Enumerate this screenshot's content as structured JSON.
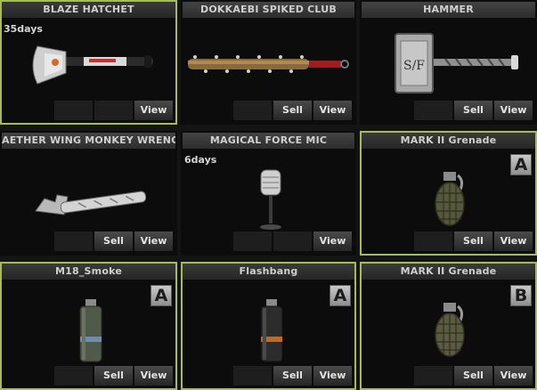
{
  "cards": [
    {
      "name": "BLAZE HATCHET",
      "days": "35days",
      "grade": "",
      "selected": true,
      "buttons": [
        "View"
      ]
    },
    {
      "name": "DOKKAEBI SPIKED CLUB",
      "days": "",
      "grade": "",
      "selected": false,
      "buttons": [
        "Sell",
        "View"
      ]
    },
    {
      "name": "HAMMER",
      "days": "",
      "grade": "",
      "selected": false,
      "buttons": [
        "Sell",
        "View"
      ]
    },
    {
      "name": "AETHER WING MONKEY WRENCH",
      "days": "",
      "grade": "",
      "selected": false,
      "buttons": [
        "Sell",
        "View"
      ]
    },
    {
      "name": "MAGICAL FORCE MIC",
      "days": "6days",
      "grade": "",
      "selected": false,
      "buttons": [
        "View"
      ]
    },
    {
      "name": "MARK II Grenade",
      "days": "",
      "grade": "A",
      "selected": true,
      "buttons": [
        "Sell",
        "View"
      ]
    },
    {
      "name": "M18_Smoke",
      "days": "",
      "grade": "A",
      "selected": true,
      "buttons": [
        "Sell",
        "View"
      ]
    },
    {
      "name": "Flashbang",
      "days": "",
      "grade": "A",
      "selected": true,
      "buttons": [
        "Sell",
        "View"
      ]
    },
    {
      "name": "MARK II Grenade",
      "days": "",
      "grade": "B",
      "selected": true,
      "buttons": [
        "Sell",
        "View"
      ]
    }
  ],
  "labels": {
    "sell": "Sell",
    "view": "View"
  },
  "hammer_emblem": "S/F",
  "colors": {
    "selected_border": "#a7bb56",
    "header": "#3a3a3a",
    "panel": "#0c0c0c"
  }
}
